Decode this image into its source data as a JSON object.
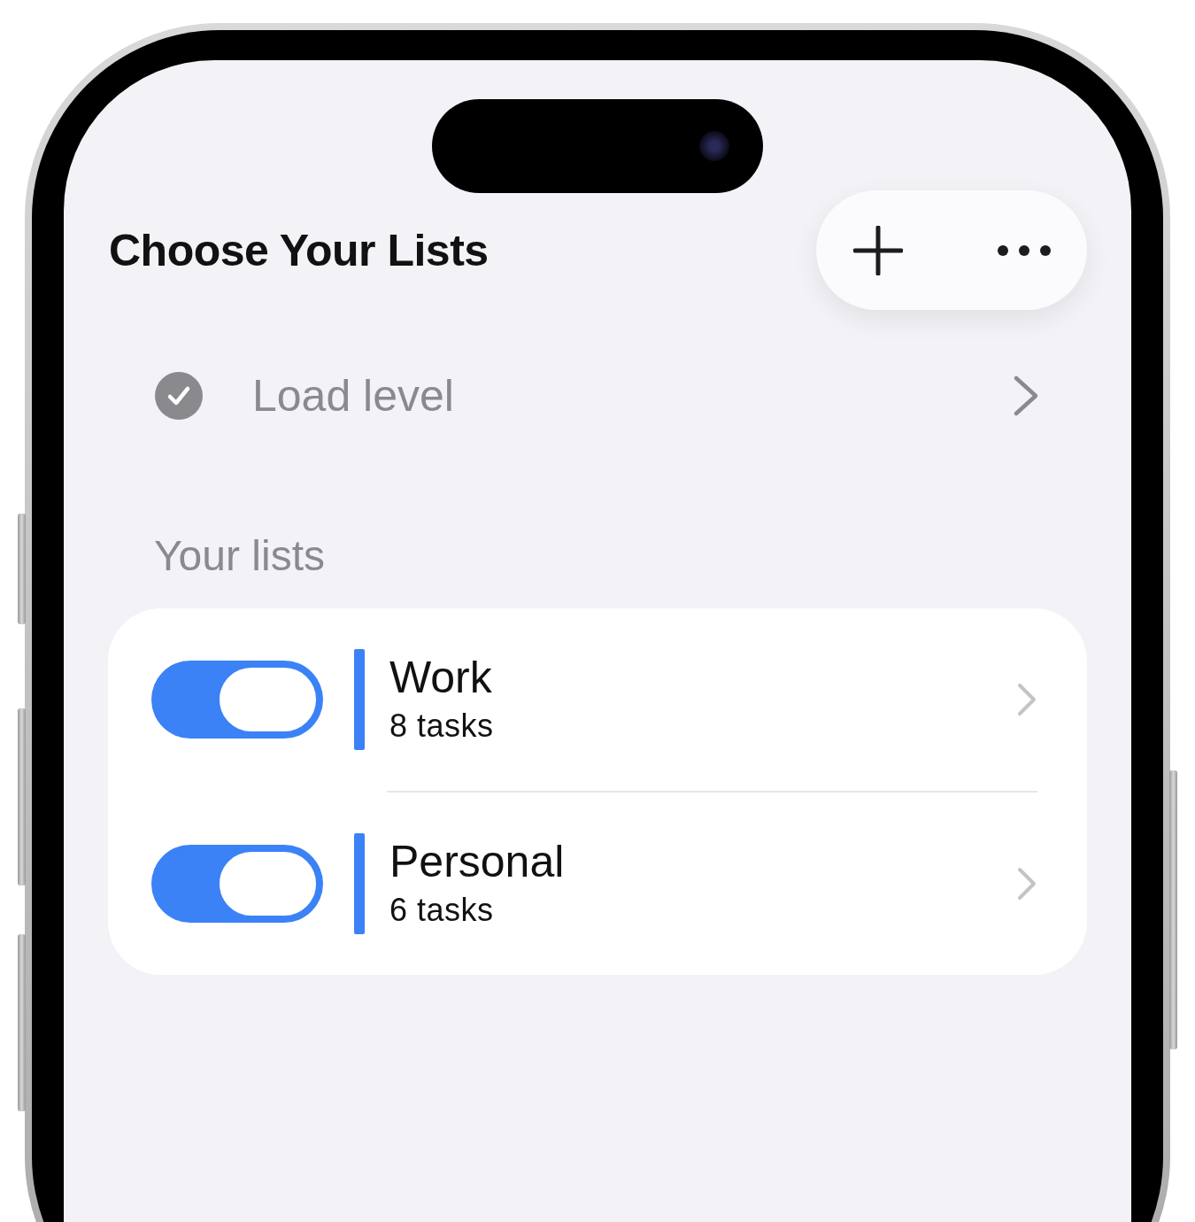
{
  "header": {
    "title": "Choose Your Lists"
  },
  "load_level": {
    "label": "Load level",
    "checked": true
  },
  "section": {
    "title": "Your lists"
  },
  "lists": [
    {
      "name": "Work",
      "count": "8 tasks",
      "on": true,
      "color": "#3b82f6"
    },
    {
      "name": "Personal",
      "count": "6 tasks",
      "on": true,
      "color": "#3b82f6"
    }
  ]
}
